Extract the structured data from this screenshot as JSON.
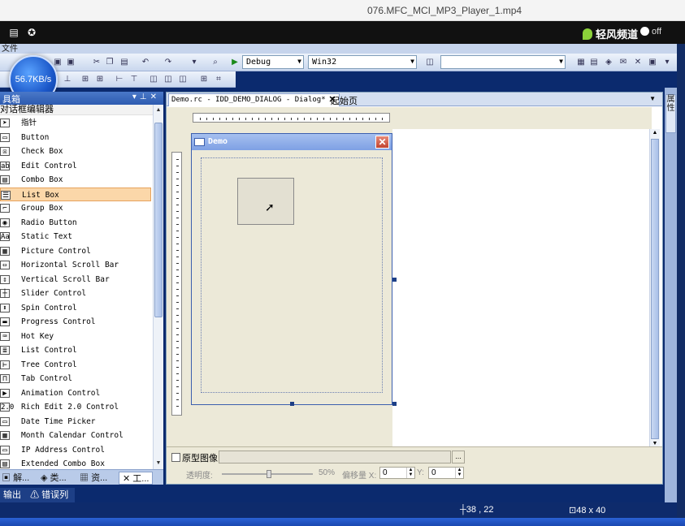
{
  "player": {
    "title": "076.MFC_MCI_MP3_Player_1.mp4",
    "brand": "轻风频道",
    "toggle": "off",
    "speed": "56.7KB/s"
  },
  "vs": {
    "config": "Debug",
    "platform": "Win32",
    "toolbox": {
      "title": "具箱",
      "category": "对话框编辑器",
      "items": [
        {
          "label": "指针",
          "icon": "pointer-icon",
          "glyph": "➤"
        },
        {
          "label": "Button",
          "icon": "button-icon",
          "glyph": "▭"
        },
        {
          "label": "Check Box",
          "icon": "checkbox-icon",
          "glyph": "☒"
        },
        {
          "label": "Edit Control",
          "icon": "edit-control-icon",
          "glyph": "ab"
        },
        {
          "label": "Combo Box",
          "icon": "combo-box-icon",
          "glyph": "▤"
        },
        {
          "label": "List Box",
          "icon": "list-box-icon",
          "glyph": "☰"
        },
        {
          "label": "Group Box",
          "icon": "group-box-icon",
          "glyph": "⌐"
        },
        {
          "label": "Radio Button",
          "icon": "radio-button-icon",
          "glyph": "◉"
        },
        {
          "label": "Static Text",
          "icon": "static-text-icon",
          "glyph": "Aa"
        },
        {
          "label": "Picture Control",
          "icon": "picture-control-icon",
          "glyph": "▦"
        },
        {
          "label": "Horizontal Scroll Bar",
          "icon": "hscroll-icon",
          "glyph": "⇔"
        },
        {
          "label": "Vertical Scroll Bar",
          "icon": "vscroll-icon",
          "glyph": "⇕"
        },
        {
          "label": "Slider Control",
          "icon": "slider-icon",
          "glyph": "┼"
        },
        {
          "label": "Spin Control",
          "icon": "spin-icon",
          "glyph": "⬍"
        },
        {
          "label": "Progress Control",
          "icon": "progress-icon",
          "glyph": "▬"
        },
        {
          "label": "Hot Key",
          "icon": "hot-key-icon",
          "glyph": "⌨"
        },
        {
          "label": "List Control",
          "icon": "list-control-icon",
          "glyph": "≣"
        },
        {
          "label": "Tree Control",
          "icon": "tree-control-icon",
          "glyph": "⊢"
        },
        {
          "label": "Tab Control",
          "icon": "tab-control-icon",
          "glyph": "⊓"
        },
        {
          "label": "Animation Control",
          "icon": "animation-icon",
          "glyph": "▶"
        },
        {
          "label": "Rich Edit 2.0 Control",
          "icon": "rich-edit-icon",
          "glyph": "2.0"
        },
        {
          "label": "Date Time Picker",
          "icon": "date-time-icon",
          "glyph": "▭"
        },
        {
          "label": "Month Calendar Control",
          "icon": "calendar-icon",
          "glyph": "▦"
        },
        {
          "label": "IP Address Control",
          "icon": "ip-address-icon",
          "glyph": "▭"
        },
        {
          "label": "Extended Combo Box",
          "icon": "ext-combo-icon",
          "glyph": "▤"
        }
      ]
    },
    "bottom_tabs": [
      "解...",
      "类...",
      "资...",
      "工..."
    ],
    "output_tabs": [
      "输出",
      "错误列表"
    ],
    "editor": {
      "doc_tab": "Demo.rc - IDD_DEMO_DIALOG - Dialog*",
      "start_tab": "起始页",
      "dialog_title": "Demo",
      "proto_label": "原型图像:",
      "transparency_label": "透明度:",
      "transparency_value": "50%",
      "offset_x_label": "偏移量 X:",
      "offset_x": "0",
      "offset_y_label": "Y:",
      "offset_y": "0"
    },
    "status": {
      "position": "38 , 22",
      "size": "48 x 40"
    },
    "right_tab": "属性"
  }
}
